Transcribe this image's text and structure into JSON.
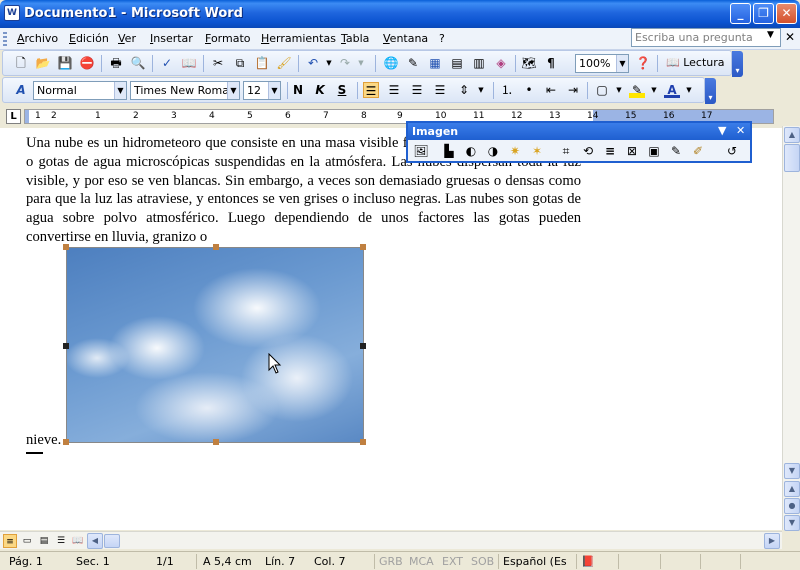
{
  "window": {
    "title": "Documento1 - Microsoft Word",
    "app_icon_letter": "W"
  },
  "menu": [
    "Archivo",
    "Edición",
    "Ver",
    "Insertar",
    "Formato",
    "Herramientas",
    "Tabla",
    "Ventana",
    "?"
  ],
  "help_box": {
    "placeholder": "Escriba una pregunta"
  },
  "toolbar_standard": {
    "zoom": "100%",
    "reading_label": "Lectura"
  },
  "toolbar_format": {
    "style": "Normal",
    "font": "Times New Roman",
    "size": "12"
  },
  "ruler": {
    "numbers": [
      "1",
      "2",
      "1",
      "2",
      "3",
      "4",
      "5",
      "6",
      "7",
      "8",
      "9",
      "10",
      "11",
      "12",
      "13",
      "14",
      "15",
      "16",
      "17"
    ]
  },
  "document": {
    "paragraph": "Una nube es un hidrometeoro que consiste en una masa visible formada por cristales de nieve o gotas de agua microscópicas suspendidas en la atmósfera. Las nubes dispersan toda la luz visible, y por eso se ven blancas. Sin embargo, a veces son demasiado gruesas o densas como para que la luz las atraviese, y entonces se ven grises o incluso negras. Las nubes son gotas de agua sobre polvo atmosférico. Luego dependiendo de unos factores las gotas pueden convertirse en lluvia, granizo o",
    "trailing_word": "nieve."
  },
  "image_toolbar": {
    "title": "Imagen"
  },
  "status_bar": {
    "page": "Pág. 1",
    "section": "Sec. 1",
    "pages": "1/1",
    "at": "A 5,4 cm",
    "line": "Lín. 7",
    "column": "Col. 7",
    "grb": "GRB",
    "mca": "MCA",
    "ext": "EXT",
    "sob": "SOB",
    "language": "Español (Es"
  }
}
